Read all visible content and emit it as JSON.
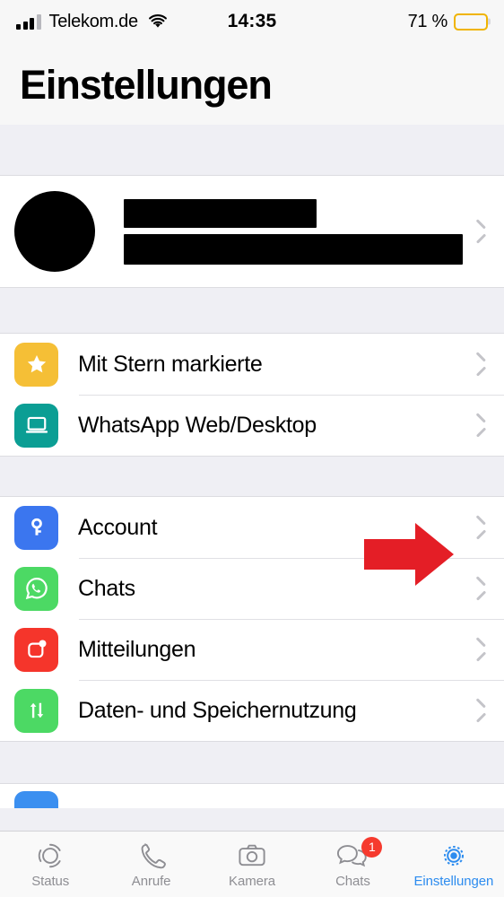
{
  "status_bar": {
    "carrier": "Telekom.de",
    "time": "14:35",
    "battery_percent": "71 %",
    "signal_icon": "cellular-signal-icon",
    "wifi_icon": "wifi-icon",
    "battery_icon": "battery-icon",
    "battery_color": "#fcc300",
    "signal_bars_filled": 3,
    "signal_bars_total": 4
  },
  "header": {
    "title": "Einstellungen"
  },
  "profile": {
    "name_redacted": true,
    "status_redacted": true,
    "avatar_redacted": true,
    "chevron_icon": "chevron-right-icon"
  },
  "groups": [
    {
      "rows": [
        {
          "label": "Mit Stern markierte",
          "icon": "star-icon",
          "icon_color": "#f5bf36"
        },
        {
          "label": "WhatsApp Web/Desktop",
          "icon": "laptop-icon",
          "icon_color": "#0b9e94"
        }
      ]
    },
    {
      "rows": [
        {
          "label": "Account",
          "icon": "key-icon",
          "icon_color": "#3b76ef"
        },
        {
          "label": "Chats",
          "icon": "whatsapp-icon",
          "icon_color": "#4cd964"
        },
        {
          "label": "Mitteilungen",
          "icon": "notification-icon",
          "icon_color": "#f5352b"
        },
        {
          "label": "Daten- und Speichernutzung",
          "icon": "data-transfer-icon",
          "icon_color": "#4cd964"
        }
      ]
    }
  ],
  "partial_group": {
    "icon": "blue-app-icon",
    "icon_color": "#3b8ff0"
  },
  "annotation": {
    "arrow_icon": "red-arrow-pointing-right",
    "arrow_color": "#e41e26",
    "points_at": "Account"
  },
  "tab_bar": {
    "tabs": [
      {
        "label": "Status",
        "icon": "status-rings-icon",
        "active": false,
        "badge": ""
      },
      {
        "label": "Anrufe",
        "icon": "phone-icon",
        "active": false,
        "badge": ""
      },
      {
        "label": "Kamera",
        "icon": "camera-icon",
        "active": false,
        "badge": ""
      },
      {
        "label": "Chats",
        "icon": "chat-bubbles-icon",
        "active": false,
        "badge": "1"
      },
      {
        "label": "Einstellungen",
        "icon": "gear-icon",
        "active": true,
        "badge": ""
      }
    ],
    "active_color": "#2d8cef",
    "inactive_color": "#8e8e93",
    "badge_color": "#f63a2e"
  }
}
